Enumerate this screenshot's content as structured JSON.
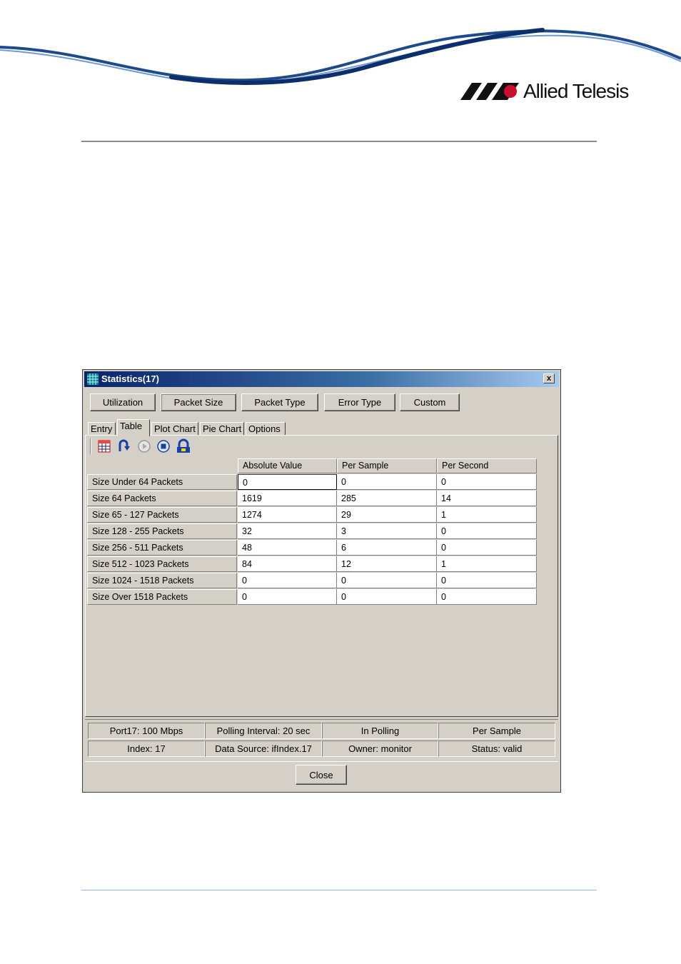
{
  "brand": {
    "name": "Allied Telesis",
    "color": "#1e4a8c"
  },
  "window": {
    "title": "Statistics(17)",
    "close_glyph": "x",
    "top_buttons": [
      {
        "label": "Utilization"
      },
      {
        "label": "Packet Size",
        "active": true
      },
      {
        "label": "Packet Type"
      },
      {
        "label": "Error Type"
      },
      {
        "label": "Custom"
      }
    ],
    "tabs": [
      {
        "label": "Entry"
      },
      {
        "label": "Table",
        "selected": true
      },
      {
        "label": "Plot Chart"
      },
      {
        "label": "Pie Chart"
      },
      {
        "label": "Options"
      }
    ],
    "toolbar_icons": [
      "grid-icon",
      "refresh-icon",
      "play-icon",
      "stop-icon",
      "poll-icon"
    ],
    "table": {
      "columns": [
        "Absolute Value",
        "Per Sample",
        "Per Second"
      ],
      "rows": [
        {
          "label": "Size Under 64 Packets",
          "values": [
            "0",
            "0",
            "0"
          ]
        },
        {
          "label": "Size 64 Packets",
          "values": [
            "1619",
            "285",
            "14"
          ]
        },
        {
          "label": "Size 65 - 127 Packets",
          "values": [
            "1274",
            "29",
            "1"
          ]
        },
        {
          "label": "Size 128 - 255 Packets",
          "values": [
            "32",
            "3",
            "0"
          ]
        },
        {
          "label": "Size 256 - 511 Packets",
          "values": [
            "48",
            "6",
            "0"
          ]
        },
        {
          "label": "Size 512 - 1023 Packets",
          "values": [
            "84",
            "12",
            "1"
          ]
        },
        {
          "label": "Size 1024 - 1518 Packets",
          "values": [
            "0",
            "0",
            "0"
          ]
        },
        {
          "label": "Size Over 1518 Packets",
          "values": [
            "0",
            "0",
            "0"
          ]
        }
      ]
    },
    "status": {
      "row1": [
        "Port17: 100 Mbps",
        "Polling Interval: 20 sec",
        "In Polling",
        "Per Sample"
      ],
      "row2": [
        "Index: 17",
        "Data Source: ifIndex.17",
        "Owner: monitor",
        "Status: valid"
      ]
    },
    "close_button": "Close"
  }
}
